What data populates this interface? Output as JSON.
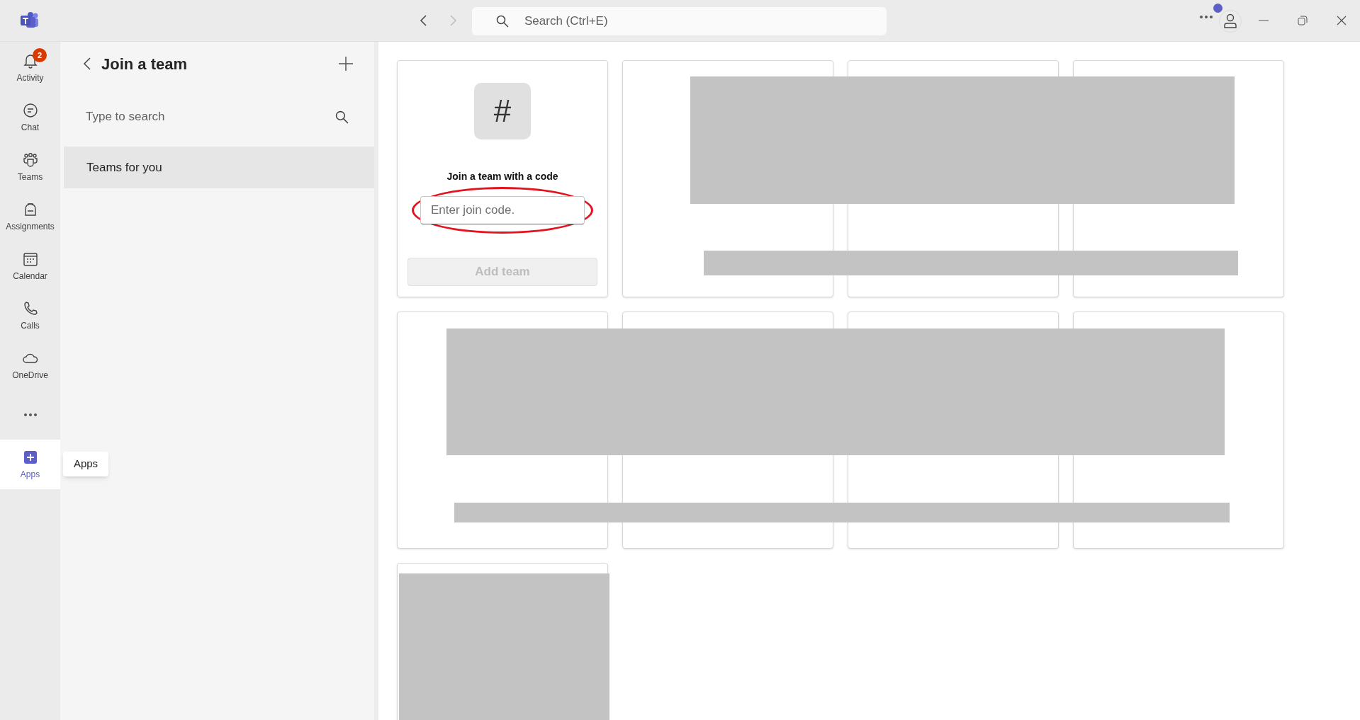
{
  "title_bar": {
    "search": {
      "placeholder": "Search (Ctrl+E)"
    },
    "presence_dot": {
      "color": "#5b5fc7"
    }
  },
  "nav": [
    {
      "label": "Activity",
      "badge": "2",
      "selected": false
    },
    {
      "label": "Chat",
      "selected": false
    },
    {
      "label": "Teams",
      "selected": false
    },
    {
      "label": "Assignments",
      "selected": false
    },
    {
      "label": "Calendar",
      "selected": false
    },
    {
      "label": "Calls",
      "selected": false
    },
    {
      "label": "OneDrive",
      "selected": false
    },
    {
      "label": "Apps",
      "selected": true
    }
  ],
  "tooltip": "Apps",
  "side_panel": {
    "title": "Join a team",
    "search": {
      "placeholder": "Type to search"
    },
    "items": [
      {
        "label": "Teams for you",
        "selected": true
      }
    ]
  },
  "join_card": {
    "icon": "#",
    "heading": "Join a team with a code",
    "code_field": {
      "placeholder": "Enter join code."
    },
    "button": {
      "label": "Add team",
      "disabled": true
    }
  }
}
